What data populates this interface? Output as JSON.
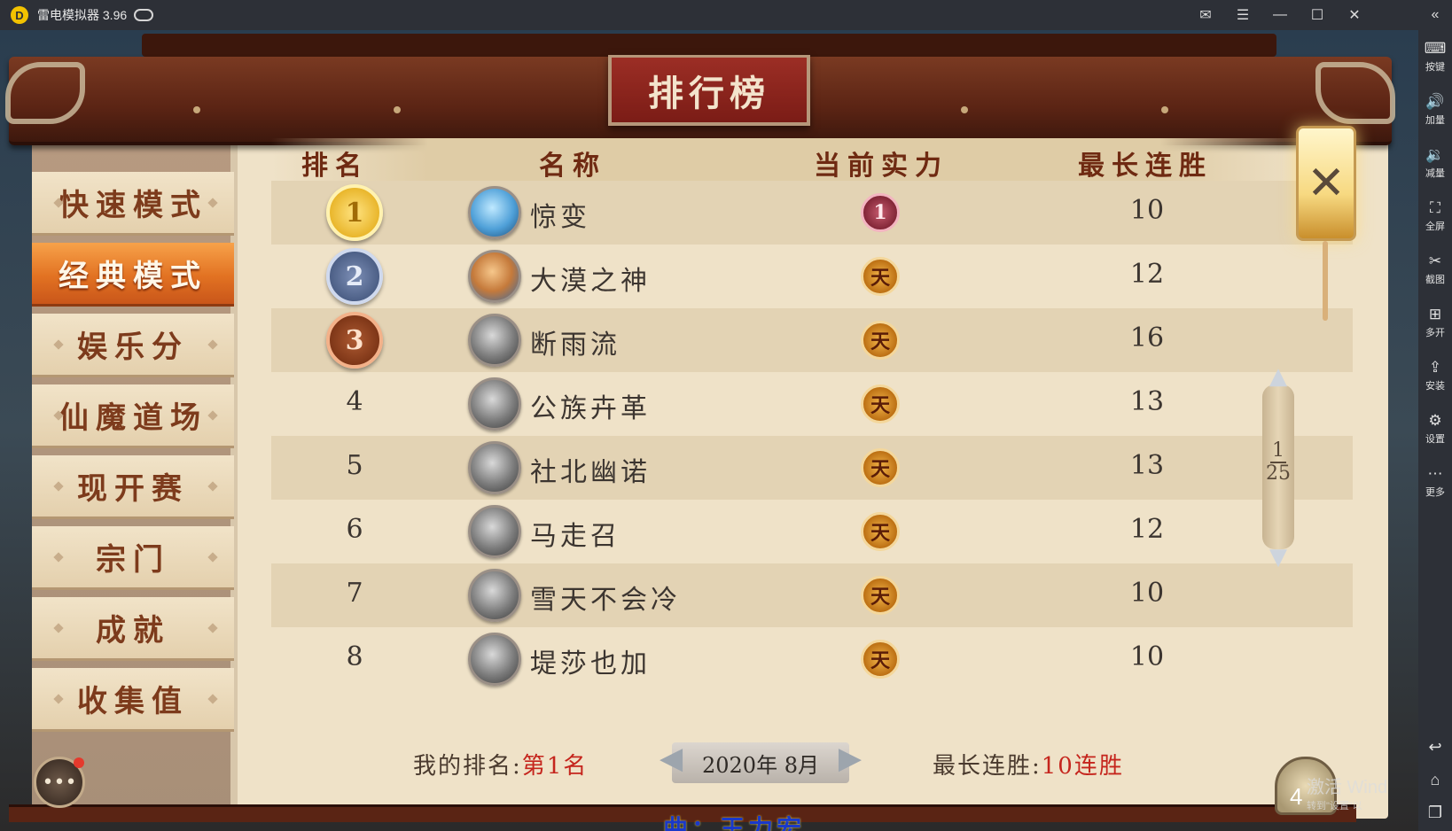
{
  "emulator": {
    "title": "雷电模拟器 3.96",
    "logo_icon": "thunder-logo-icon",
    "window_controls": [
      "mail-icon",
      "menu-icon",
      "minimize-icon",
      "maximize-icon",
      "close-icon"
    ]
  },
  "sidebar": {
    "collapse_icon": "double-chevron-left-icon",
    "items": [
      {
        "label": "按键",
        "icon": "keyboard-icon"
      },
      {
        "label": "加量",
        "icon": "volume-up-icon"
      },
      {
        "label": "减量",
        "icon": "volume-down-icon"
      },
      {
        "label": "全屏",
        "icon": "fullscreen-icon"
      },
      {
        "label": "截图",
        "icon": "scissors-icon"
      },
      {
        "label": "多开",
        "icon": "multi-instance-icon"
      },
      {
        "label": "安装",
        "icon": "apk-install-icon"
      },
      {
        "label": "设置",
        "icon": "gear-icon"
      },
      {
        "label": "更多",
        "icon": "more-icon"
      }
    ],
    "bottom": [
      "back-icon",
      "home-icon",
      "recent-apps-icon"
    ]
  },
  "game": {
    "board_title": "排行榜",
    "nav": [
      {
        "label": "快速模式",
        "active": false
      },
      {
        "label": "经典模式",
        "active": true
      },
      {
        "label": "娱乐分",
        "active": false
      },
      {
        "label": "仙魔道场",
        "active": false
      },
      {
        "label": "现开赛",
        "active": false
      },
      {
        "label": "宗门",
        "active": false
      },
      {
        "label": "成就",
        "active": false
      },
      {
        "label": "收集值",
        "active": false
      }
    ],
    "table": {
      "headers": {
        "rank": "排名",
        "name": "名称",
        "power": "当前实力",
        "streak": "最长连胜"
      },
      "rows": [
        {
          "rank": "1",
          "name": "惊变",
          "power": "1",
          "streak": "10"
        },
        {
          "rank": "2",
          "name": "大漠之神",
          "power": "天",
          "streak": "12"
        },
        {
          "rank": "3",
          "name": "断雨流",
          "power": "天",
          "streak": "16"
        },
        {
          "rank": "4",
          "name": "公族卉革",
          "power": "天",
          "streak": "13"
        },
        {
          "rank": "5",
          "name": "社北幽诺",
          "power": "天",
          "streak": "13"
        },
        {
          "rank": "6",
          "name": "马走召",
          "power": "天",
          "streak": "12"
        },
        {
          "rank": "7",
          "name": "雪天不会冷",
          "power": "天",
          "streak": "10"
        },
        {
          "rank": "8",
          "name": "堤莎也加",
          "power": "天",
          "streak": "10"
        }
      ]
    },
    "pager": {
      "current": "1",
      "total": "25"
    },
    "footer": {
      "my_rank_label": "我的排名:",
      "my_rank_value": "第1名",
      "date": "2020年 8月",
      "streak_label": "最长连胜:",
      "streak_value": "10连胜"
    },
    "counter": "4",
    "watermark": {
      "line1": "激活 Wind",
      "line2": "转到\"设置\"以"
    },
    "subtitle": "曲：王力宏",
    "colors": {
      "accent_red": "#c5251d",
      "active_tab": "#e27222",
      "parchment": "#efe2c8"
    }
  }
}
